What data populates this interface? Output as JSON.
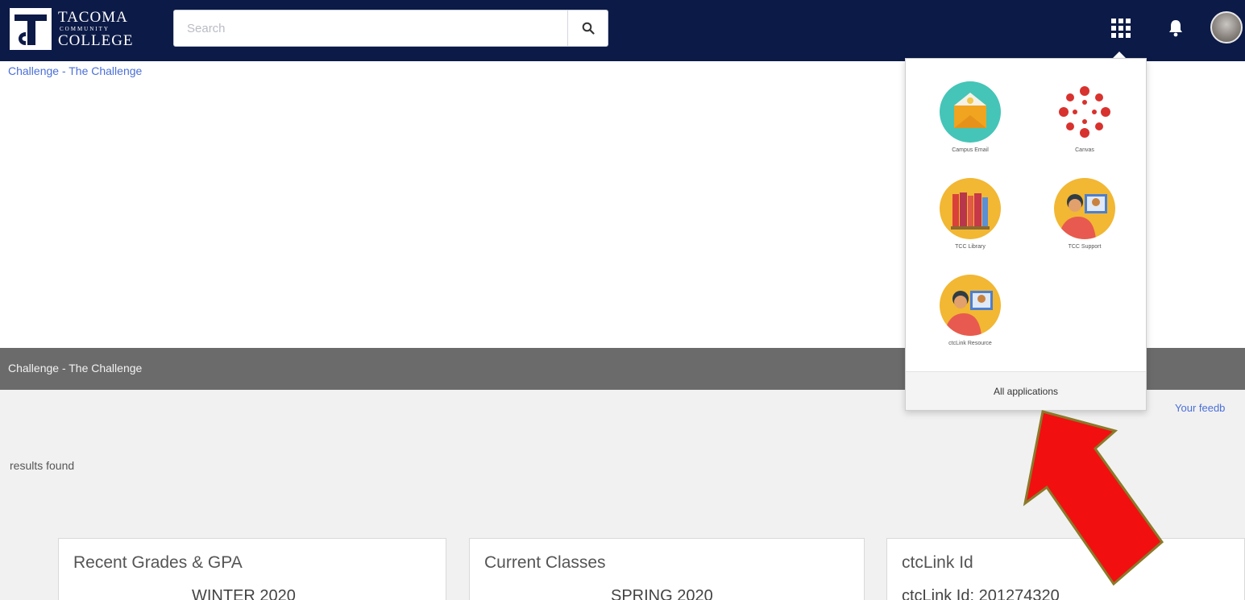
{
  "header": {
    "logo": {
      "line1": "TACOMA",
      "line2": "COMMUNITY",
      "line3": "COLLEGE"
    },
    "search": {
      "placeholder": "Search",
      "value": ""
    },
    "icons": {
      "search": "search-icon",
      "apps": "grid-icon",
      "notifications": "bell-icon",
      "avatar": "user-avatar"
    }
  },
  "breadcrumb": "Challenge - The Challenge",
  "banner": {
    "title": "Challenge - The Challenge"
  },
  "feedback_link": "Your feedb",
  "results_text": "results found",
  "cards": [
    {
      "title": "Recent Grades & GPA",
      "sub": "WINTER 2020"
    },
    {
      "title": "Current Classes",
      "sub": "SPRING 2020"
    },
    {
      "title": "ctcLink Id",
      "sub": "ctcLink Id: 201274320"
    }
  ],
  "apps_menu": {
    "items": [
      {
        "label": "Campus Email",
        "icon": "envelope-icon"
      },
      {
        "label": "Canvas",
        "icon": "canvas-icon"
      },
      {
        "label": "TCC Library",
        "icon": "books-icon"
      },
      {
        "label": "TCC Support",
        "icon": "support-people-icon"
      },
      {
        "label": "ctcLink Resource",
        "icon": "resource-people-icon"
      }
    ],
    "footer_label": "All applications"
  },
  "colors": {
    "nav": "#0c1a47",
    "banner": "#6b6b6b",
    "link": "#4a6fd8",
    "arrow": "#f20f0f",
    "arrow_outline": "#8a7a2a"
  }
}
